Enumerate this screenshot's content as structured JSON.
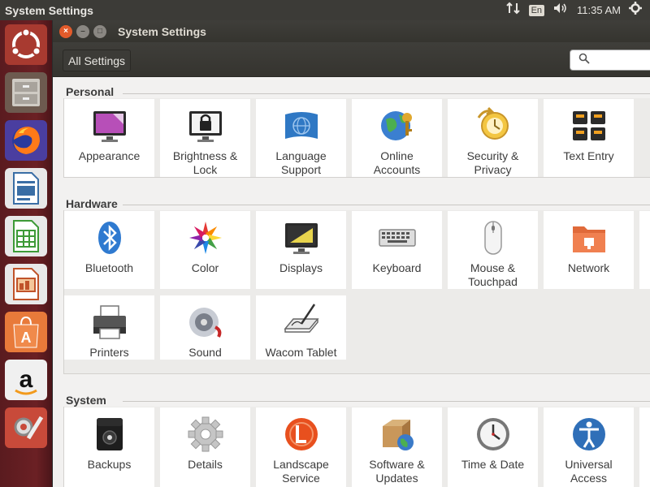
{
  "top_panel": {
    "title": "System Settings",
    "language": "En",
    "clock": "11:35 AM"
  },
  "window": {
    "title": "System Settings",
    "all_settings_label": "All Settings",
    "search_placeholder": ""
  },
  "sections": {
    "personal": {
      "title": "Personal",
      "items": [
        {
          "label": "Appearance",
          "icon": "appearance-icon"
        },
        {
          "label": "Brightness &\nLock",
          "icon": "brightness-lock-icon"
        },
        {
          "label": "Language\nSupport",
          "icon": "language-support-icon"
        },
        {
          "label": "Online\nAccounts",
          "icon": "online-accounts-icon"
        },
        {
          "label": "Security &\nPrivacy",
          "icon": "security-privacy-icon"
        },
        {
          "label": "Text Entry",
          "icon": "text-entry-icon"
        }
      ]
    },
    "hardware": {
      "title": "Hardware",
      "items": [
        {
          "label": "Bluetooth",
          "icon": "bluetooth-icon"
        },
        {
          "label": "Color",
          "icon": "color-icon"
        },
        {
          "label": "Displays",
          "icon": "displays-icon"
        },
        {
          "label": "Keyboard",
          "icon": "keyboard-icon"
        },
        {
          "label": "Mouse &\nTouchpad",
          "icon": "mouse-touchpad-icon"
        },
        {
          "label": "Network",
          "icon": "network-icon"
        },
        {
          "label": "Printers",
          "icon": "printers-icon"
        },
        {
          "label": "Sound",
          "icon": "sound-icon"
        },
        {
          "label": "Wacom Tablet",
          "icon": "wacom-tablet-icon"
        }
      ]
    },
    "system": {
      "title": "System",
      "items": [
        {
          "label": "Backups",
          "icon": "backups-icon"
        },
        {
          "label": "Details",
          "icon": "details-icon"
        },
        {
          "label": "Landscape\nService",
          "icon": "landscape-service-icon"
        },
        {
          "label": "Software &\nUpdates",
          "icon": "software-updates-icon"
        },
        {
          "label": "Time & Date",
          "icon": "time-date-icon"
        },
        {
          "label": "Universal\nAccess",
          "icon": "universal-access-icon"
        }
      ]
    }
  },
  "launcher": [
    {
      "name": "ubuntu-dash-icon"
    },
    {
      "name": "files-icon"
    },
    {
      "name": "firefox-icon"
    },
    {
      "name": "libreoffice-writer-icon"
    },
    {
      "name": "libreoffice-calc-icon"
    },
    {
      "name": "libreoffice-impress-icon"
    },
    {
      "name": "software-center-icon"
    },
    {
      "name": "amazon-icon"
    },
    {
      "name": "system-settings-icon"
    }
  ],
  "colors": {
    "panel": "#3c3b37",
    "launcher": "#6b2024",
    "close_button": "#e25b2b",
    "tile": "#ffffff"
  }
}
